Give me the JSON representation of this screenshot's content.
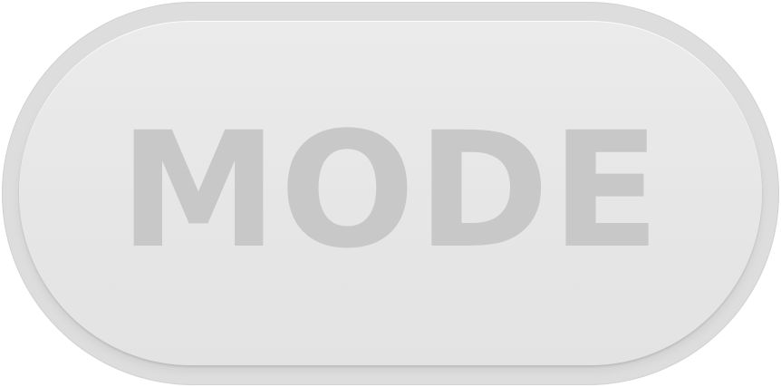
{
  "button": {
    "label": "MODE"
  },
  "colors": {
    "rim": "#dddddd",
    "face": "#e6e6e6",
    "label": "#c8c8c8"
  }
}
